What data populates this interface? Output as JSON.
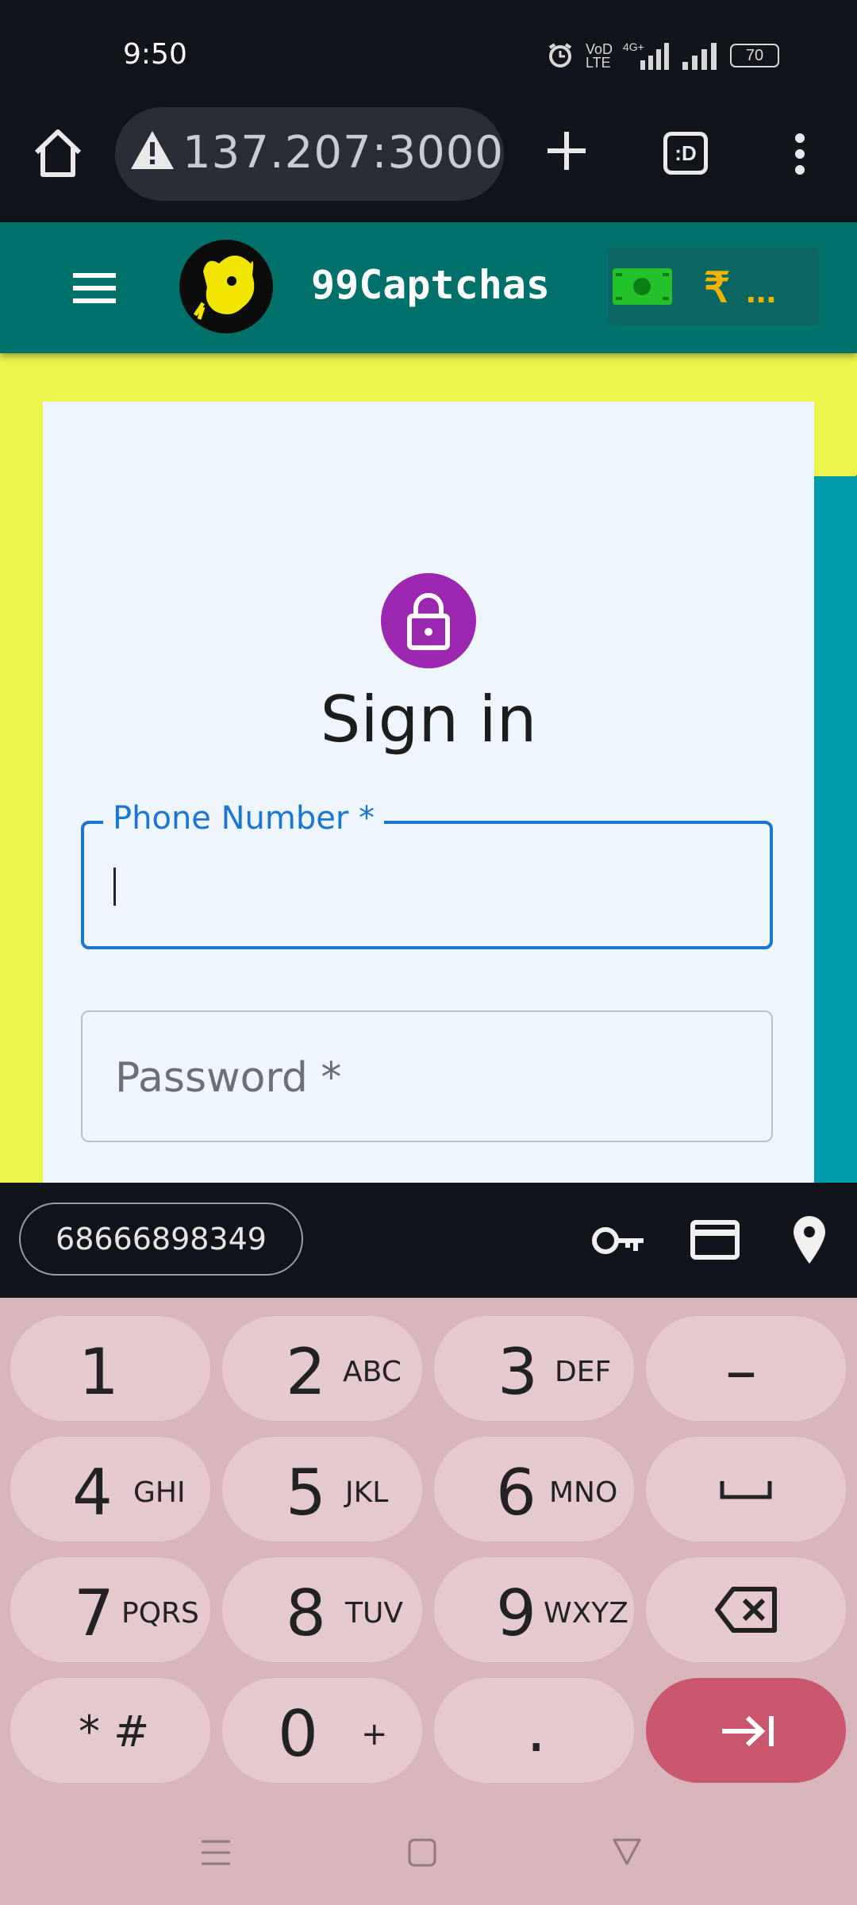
{
  "status_bar": {
    "time": "9:50",
    "battery": "70",
    "network": "4G+"
  },
  "browser": {
    "url": "137.207:3000",
    "tab_label": ":D"
  },
  "app": {
    "brand": "99Captchas",
    "balance_prefix": "₹",
    "balance_value": "..."
  },
  "signin": {
    "title": "Sign in",
    "phone_label": "Phone Number",
    "phone_value": "",
    "password_label": "Password",
    "required_mark": "*"
  },
  "autofill": {
    "suggestion": "68666898349"
  },
  "keyboard": {
    "keys": [
      {
        "digit": "1",
        "letters": ""
      },
      {
        "digit": "2",
        "letters": "ABC"
      },
      {
        "digit": "3",
        "letters": "DEF"
      },
      {
        "digit": "–",
        "letters": ""
      },
      {
        "digit": "4",
        "letters": "GHI"
      },
      {
        "digit": "5",
        "letters": "JKL"
      },
      {
        "digit": "6",
        "letters": "MNO"
      },
      {
        "digit": "␣",
        "letters": ""
      },
      {
        "digit": "7",
        "letters": "PQRS"
      },
      {
        "digit": "8",
        "letters": "TUV"
      },
      {
        "digit": "9",
        "letters": "WXYZ"
      },
      {
        "digit": "⌫",
        "letters": ""
      },
      {
        "digit": "* #",
        "letters": ""
      },
      {
        "digit": "0",
        "letters": "+"
      },
      {
        "digit": ".",
        "letters": ""
      },
      {
        "digit": "⇥",
        "letters": ""
      }
    ]
  },
  "colors": {
    "accent": "#1976d2",
    "header": "#00716a",
    "lock": "#9c27b0",
    "go_key": "#c9566c"
  }
}
